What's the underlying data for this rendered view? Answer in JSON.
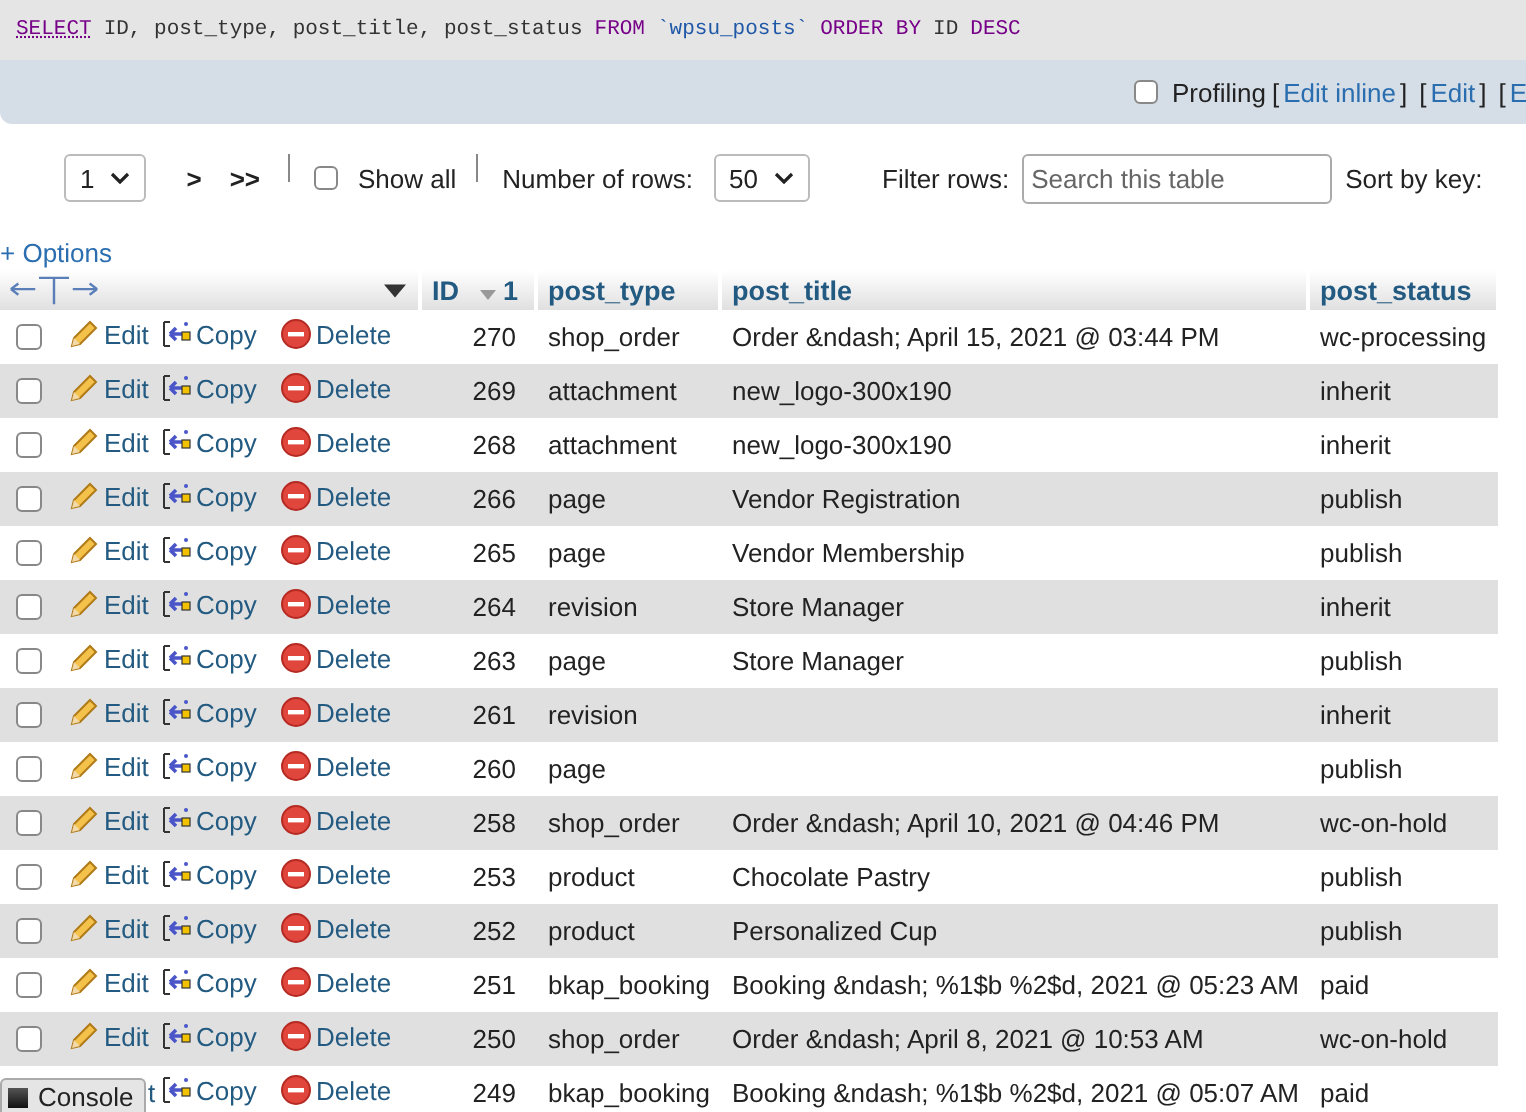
{
  "sql": [
    {
      "kind": "keyword",
      "text": "SELECT"
    },
    {
      "kind": "plain",
      "text": "ID, post_type, post_title, post_status"
    },
    {
      "kind": "keyword",
      "text": "FROM"
    },
    {
      "kind": "table",
      "text": "`wpsu_posts`"
    },
    {
      "kind": "keyword",
      "text": "ORDER BY"
    },
    {
      "kind": "plain",
      "text": "ID"
    },
    {
      "kind": "keyword",
      "text": "DESC"
    }
  ],
  "profiling": {
    "label": "Profiling",
    "checked": false,
    "items": [
      {
        "kind": "bracket",
        "text": "["
      },
      {
        "kind": "link",
        "text": "Edit inline"
      },
      {
        "kind": "bracket",
        "text": "]"
      },
      {
        "kind": "bracket",
        "text": "["
      },
      {
        "kind": "link",
        "text": "Edit"
      },
      {
        "kind": "bracket",
        "text": "]"
      },
      {
        "kind": "bracket",
        "text": "["
      },
      {
        "kind": "link",
        "text": "E"
      }
    ]
  },
  "nav": {
    "page": "1",
    "next": ">",
    "last": ">>",
    "show_all": {
      "label": "Show all",
      "checked": false
    },
    "rows_label": "Number of rows:",
    "rows_value": "50",
    "filter_label": "Filter rows:",
    "filter_placeholder": "Search this table",
    "sort_label": "Sort by key:"
  },
  "options": "+ Options",
  "columns": [
    {
      "label": "ID",
      "sort": "1"
    },
    {
      "label": "post_type"
    },
    {
      "label": "post_title"
    },
    {
      "label": "post_status"
    }
  ],
  "rows": [
    {
      "checked": false,
      "edit": "Edit",
      "copy": "Copy",
      "delete": "Delete",
      "cells": [
        "270",
        "shop_order",
        "Order &ndash; April 15, 2021 @ 03:44 PM",
        "wc-processing"
      ]
    },
    {
      "checked": false,
      "edit": "Edit",
      "copy": "Copy",
      "delete": "Delete",
      "cells": [
        "269",
        "attachment",
        "new_logo-300x190",
        "inherit"
      ]
    },
    {
      "checked": false,
      "edit": "Edit",
      "copy": "Copy",
      "delete": "Delete",
      "cells": [
        "268",
        "attachment",
        "new_logo-300x190",
        "inherit"
      ]
    },
    {
      "checked": false,
      "edit": "Edit",
      "copy": "Copy",
      "delete": "Delete",
      "cells": [
        "266",
        "page",
        "Vendor Registration",
        "publish"
      ]
    },
    {
      "checked": false,
      "edit": "Edit",
      "copy": "Copy",
      "delete": "Delete",
      "cells": [
        "265",
        "page",
        "Vendor Membership",
        "publish"
      ]
    },
    {
      "checked": false,
      "edit": "Edit",
      "copy": "Copy",
      "delete": "Delete",
      "cells": [
        "264",
        "revision",
        "Store Manager",
        "inherit"
      ]
    },
    {
      "checked": false,
      "edit": "Edit",
      "copy": "Copy",
      "delete": "Delete",
      "cells": [
        "263",
        "page",
        "Store Manager",
        "publish"
      ]
    },
    {
      "checked": false,
      "edit": "Edit",
      "copy": "Copy",
      "delete": "Delete",
      "cells": [
        "261",
        "revision",
        "",
        "inherit"
      ]
    },
    {
      "checked": false,
      "edit": "Edit",
      "copy": "Copy",
      "delete": "Delete",
      "cells": [
        "260",
        "page",
        "",
        "publish"
      ]
    },
    {
      "checked": false,
      "edit": "Edit",
      "copy": "Copy",
      "delete": "Delete",
      "cells": [
        "258",
        "shop_order",
        "Order &ndash; April 10, 2021 @ 04:46 PM",
        "wc-on-hold"
      ]
    },
    {
      "checked": false,
      "edit": "Edit",
      "copy": "Copy",
      "delete": "Delete",
      "cells": [
        "253",
        "product",
        "Chocolate Pastry",
        "publish"
      ]
    },
    {
      "checked": false,
      "edit": "Edit",
      "copy": "Copy",
      "delete": "Delete",
      "cells": [
        "252",
        "product",
        "Personalized Cup",
        "publish"
      ]
    },
    {
      "checked": false,
      "edit": "Edit",
      "copy": "Copy",
      "delete": "Delete",
      "cells": [
        "251",
        "bkap_booking",
        "Booking &ndash; %1$b %2$d, 2021 @ 05:23 AM",
        "paid"
      ]
    },
    {
      "checked": false,
      "edit": "Edit",
      "copy": "Copy",
      "delete": "Delete",
      "cells": [
        "250",
        "shop_order",
        "Order &ndash; April 8, 2021 @ 10:53 AM",
        "wc-on-hold"
      ]
    },
    {
      "edit_covered": true,
      "edit": "t",
      "copy": "Copy",
      "delete": "Delete",
      "cells": [
        "249",
        "bkap_booking",
        "Booking &ndash; %1$b %2$d, 2021 @ 05:07 AM",
        "paid"
      ]
    }
  ],
  "console": "Console"
}
